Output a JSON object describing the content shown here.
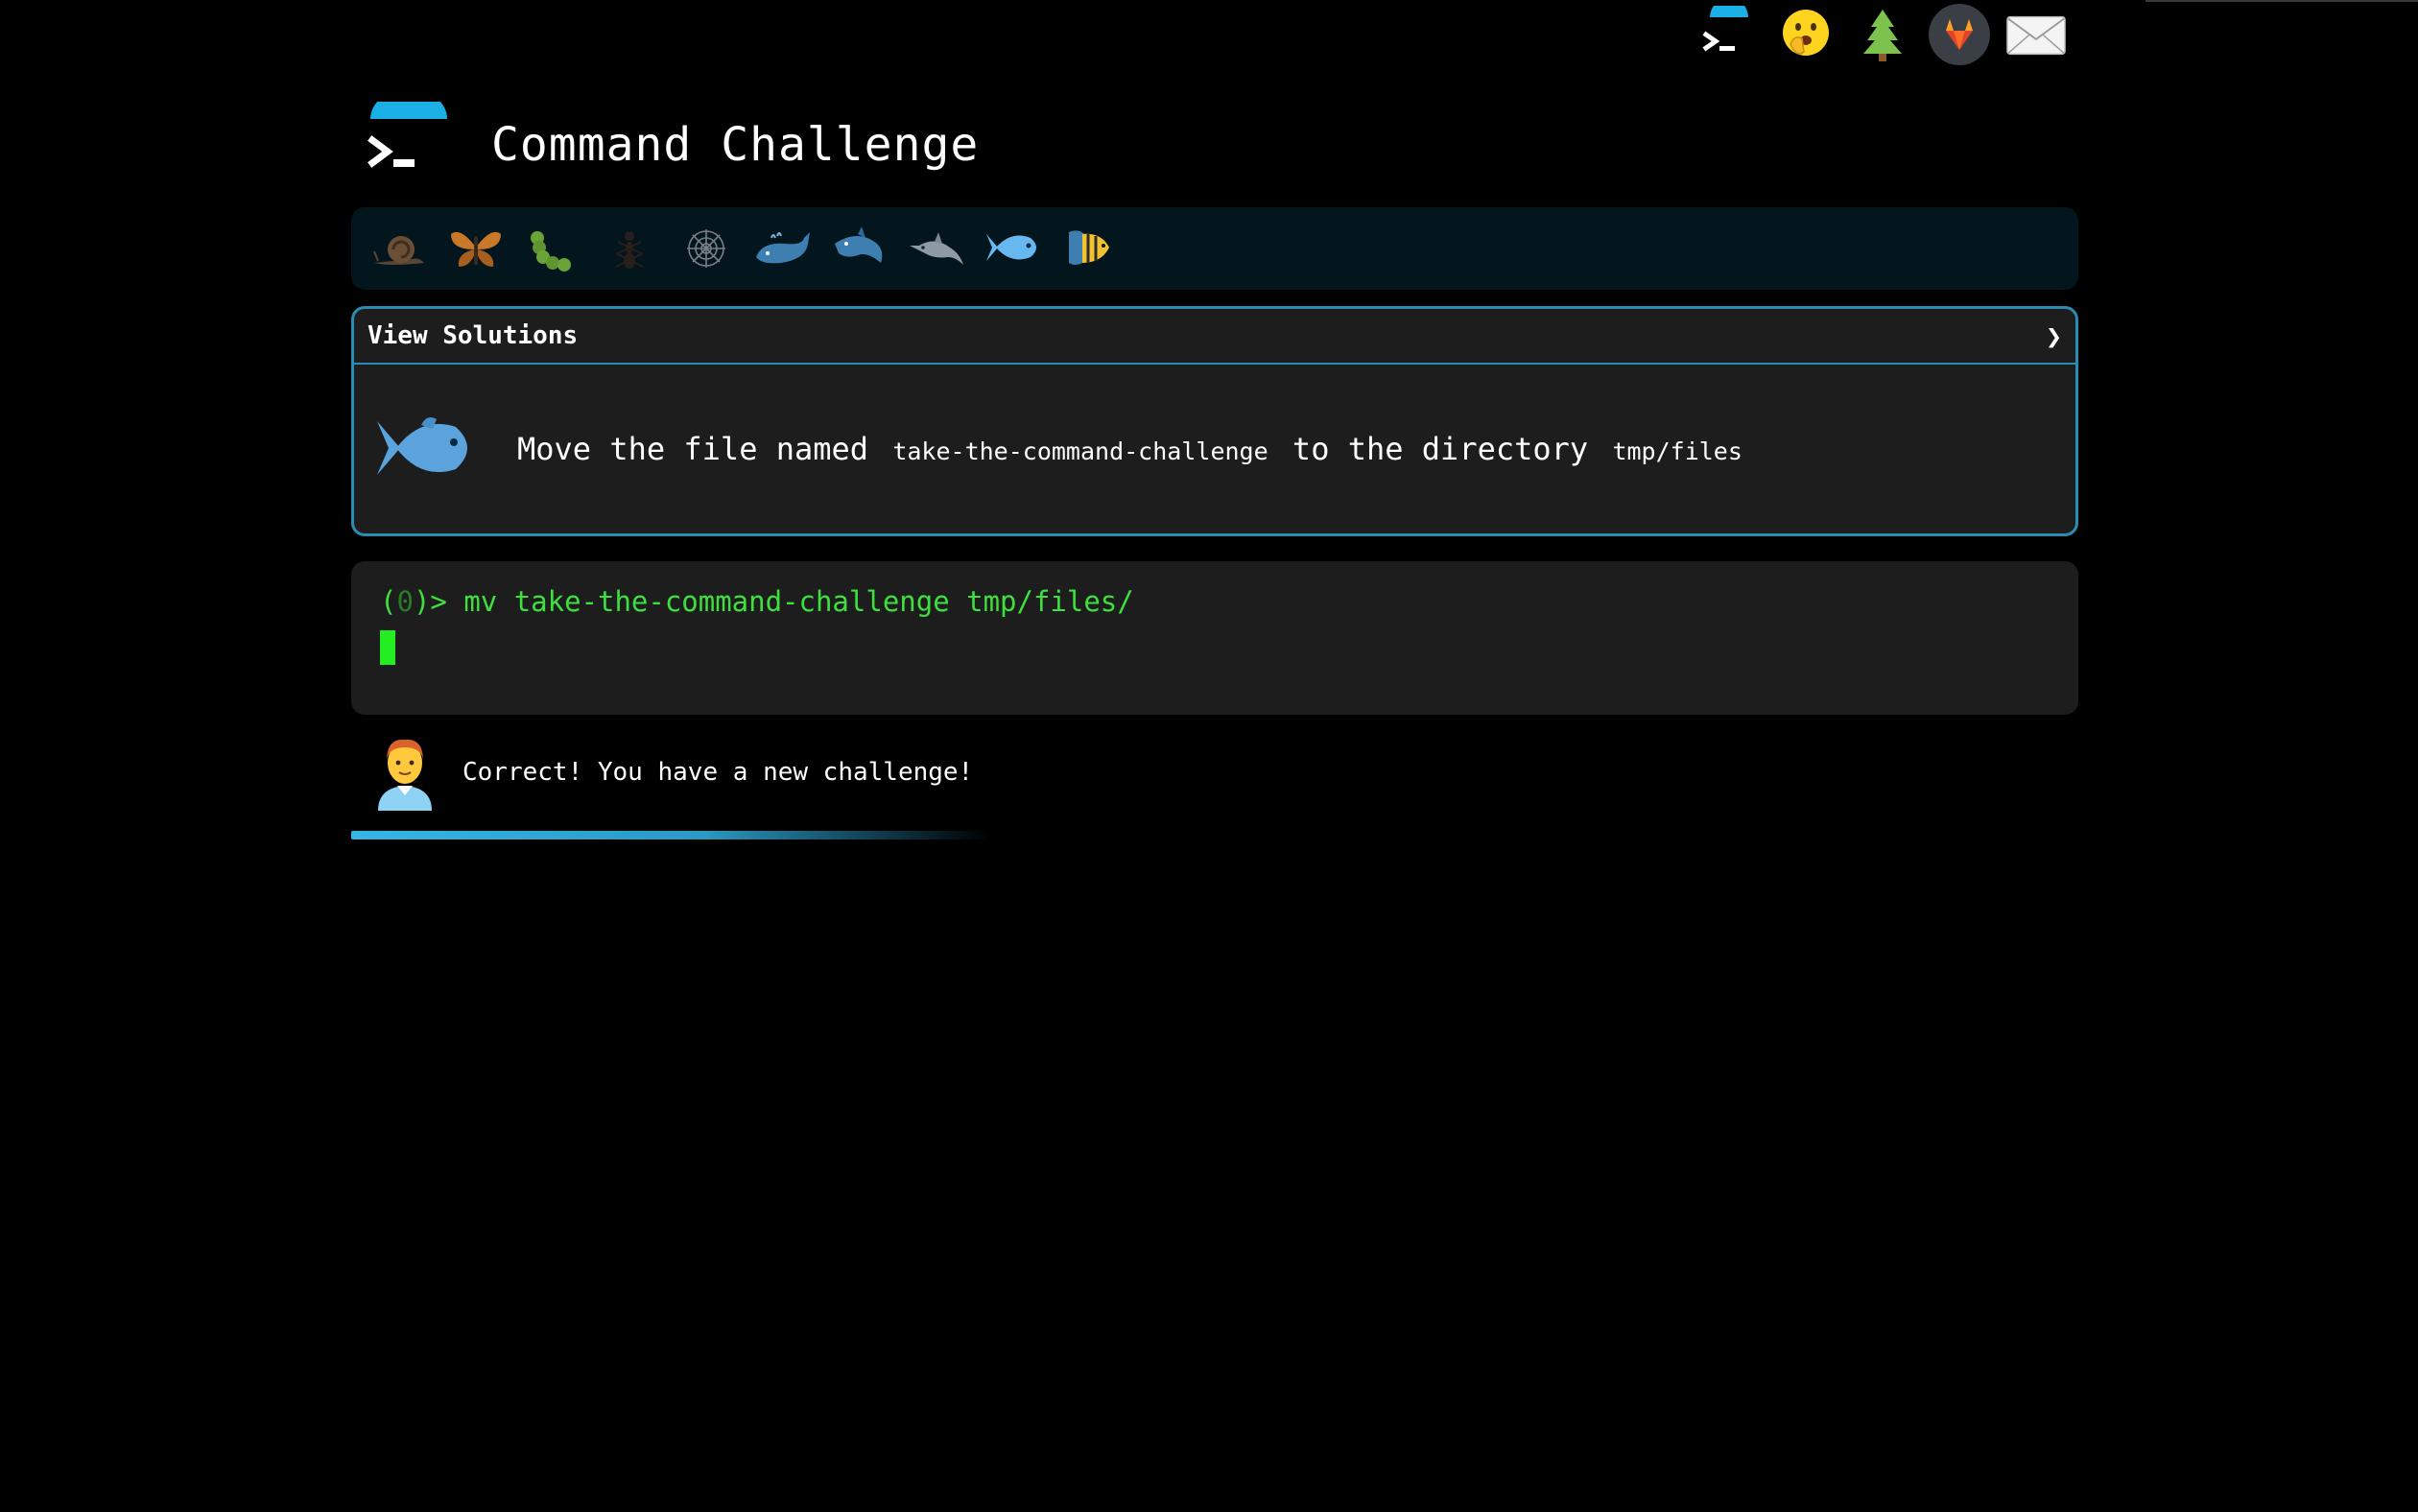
{
  "top_nav": {
    "icons": [
      "terminal-logo-icon",
      "hand-over-mouth-face-icon",
      "evergreen-tree-icon",
      "gitlab-icon",
      "envelope-icon"
    ]
  },
  "header": {
    "title": "Command Challenge"
  },
  "levels": {
    "icons": [
      "snail-icon",
      "butterfly-icon",
      "caterpillar-icon",
      "ant-icon",
      "spider-web-icon",
      "whale-icon",
      "shark-icon",
      "dolphin-icon",
      "fish-icon",
      "tropical-fish-icon"
    ],
    "current": "fish-icon"
  },
  "challenge": {
    "solutions_label": "View Solutions",
    "chevron": "❯",
    "text_prefix": "Move the file named",
    "file_name": "take-the-command-challenge",
    "text_middle": "to the directory",
    "directory": "tmp/files"
  },
  "terminal": {
    "prompt_open": "(",
    "status_code": "0",
    "prompt_close": ")> ",
    "command": "mv take-the-command-challenge tmp/files/"
  },
  "feedback": {
    "message": "Correct! You have a new challenge!"
  },
  "progress": {
    "fraction": 0.37
  },
  "colors": {
    "accent": "#2a8cb3",
    "logo_blue": "#1ab0e6",
    "terminal_green": "#3de03d",
    "panel_bg": "#1d1d1d",
    "levels_bg": "#04161d"
  }
}
